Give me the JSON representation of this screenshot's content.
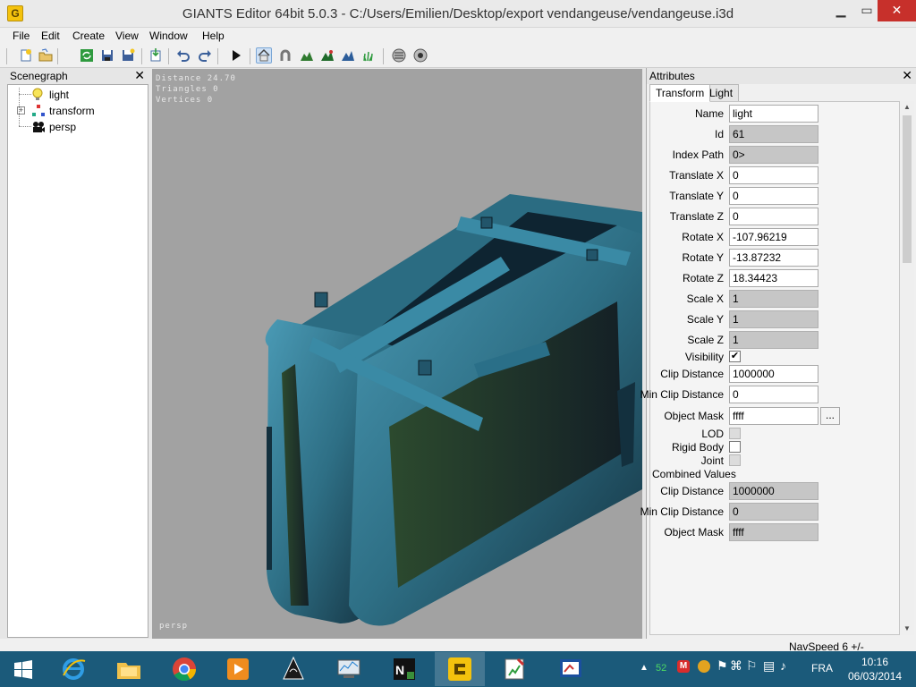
{
  "window": {
    "title": "GIANTS Editor 64bit 5.0.3 - C:/Users/Emilien/Desktop/export vendangeuse/vendangeuse.i3d",
    "app_icon_letter": "G"
  },
  "menu": [
    "File",
    "Edit",
    "Create",
    "View",
    "Window",
    "Help"
  ],
  "toolbar_icons": [
    "new-icon",
    "open-icon",
    "refresh-icon",
    "save-icon",
    "save-as-icon",
    "import-icon",
    "undo-icon",
    "redo-icon",
    "play-icon",
    "home-icon",
    "magnet-icon",
    "terrain-icon",
    "terrain-paint-icon",
    "foliage-icon",
    "grass-icon",
    "texture-icon",
    "mask-icon"
  ],
  "scenegraph": {
    "title": "Scenegraph",
    "nodes": [
      {
        "label": "light",
        "icon": "light-icon"
      },
      {
        "label": "transform",
        "icon": "transform-icon"
      },
      {
        "label": "persp",
        "icon": "camera-icon"
      }
    ]
  },
  "viewport": {
    "stats": [
      "Distance 24.70",
      "Triangles 0",
      "Vertices 0"
    ],
    "camera_name": "persp",
    "colors": {
      "background": "#a2a2a2",
      "model_main": "#2e6f85",
      "model_dark": "#13303e",
      "model_wood": "#2c4a2e"
    }
  },
  "attributes": {
    "title": "Attributes",
    "tabs": [
      "Transform",
      "Light"
    ],
    "active_tab": "Transform",
    "fields": [
      {
        "label": "Name",
        "value": "light",
        "readonly": false
      },
      {
        "label": "Id",
        "value": "61",
        "readonly": true
      },
      {
        "label": "Index Path",
        "value": "0>",
        "readonly": true
      },
      {
        "label": "Translate X",
        "value": "0",
        "readonly": false
      },
      {
        "label": "Translate Y",
        "value": "0",
        "readonly": false
      },
      {
        "label": "Translate Z",
        "value": "0",
        "readonly": false
      },
      {
        "label": "Rotate X",
        "value": "-107.96219",
        "readonly": false
      },
      {
        "label": "Rotate Y",
        "value": "-13.87232",
        "readonly": false
      },
      {
        "label": "Rotate Z",
        "value": "18.34423",
        "readonly": false
      },
      {
        "label": "Scale X",
        "value": "1",
        "readonly": true
      },
      {
        "label": "Scale Y",
        "value": "1",
        "readonly": true
      },
      {
        "label": "Scale Z",
        "value": "1",
        "readonly": true
      }
    ],
    "visibility": {
      "label": "Visibility",
      "checked": "✔"
    },
    "clip_distance": {
      "label": "Clip Distance",
      "value": "1000000"
    },
    "min_clip_distance": {
      "label": "Min Clip Distance",
      "value": "0"
    },
    "object_mask": {
      "label": "Object Mask",
      "value": "ffff",
      "button": "..."
    },
    "lod": {
      "label": "LOD"
    },
    "rigid_body": {
      "label": "Rigid Body"
    },
    "joint": {
      "label": "Joint"
    },
    "combined_values": {
      "label": "Combined Values",
      "fields": [
        {
          "label": "Clip Distance",
          "value": "1000000"
        },
        {
          "label": "Min Clip Distance",
          "value": "0"
        },
        {
          "label": "Object Mask",
          "value": "ffff"
        }
      ]
    }
  },
  "statusbar": {
    "text": "NavSpeed 6 +/-"
  },
  "taskbar": {
    "apps": [
      "windows-start-icon",
      "internet-explorer-icon",
      "file-explorer-icon",
      "chrome-icon",
      "media-player-icon",
      "inkscape-icon",
      "resource-monitor-icon",
      "notepad-plus-icon",
      "giants-editor-icon",
      "paint-icon",
      "presentation-icon"
    ],
    "tray_number": "52",
    "language": "FRA",
    "time": "10:16",
    "date": "06/03/2014"
  }
}
